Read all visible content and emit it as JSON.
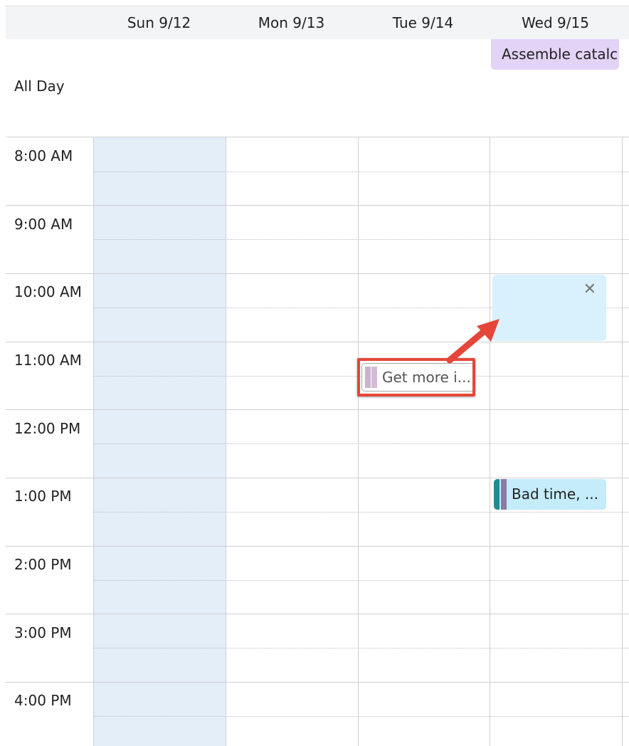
{
  "days": [
    {
      "label": "Sun 9/12"
    },
    {
      "label": "Mon 9/13"
    },
    {
      "label": "Tue 9/14"
    },
    {
      "label": "Wed 9/15"
    }
  ],
  "all_day": {
    "label": "All Day",
    "event_title": "Assemble catalc"
  },
  "hours": [
    {
      "label": "8:00 AM"
    },
    {
      "label": "9:00 AM"
    },
    {
      "label": "10:00 AM"
    },
    {
      "label": "11:00 AM"
    },
    {
      "label": "12:00 PM"
    },
    {
      "label": "1:00 PM"
    },
    {
      "label": "2:00 PM"
    },
    {
      "label": "3:00 PM"
    },
    {
      "label": "4:00 PM"
    }
  ],
  "events": {
    "get_more": {
      "title": "Get more i..."
    },
    "bad_time": {
      "title": "Bad time, ..."
    },
    "selection": {
      "close_icon": "close-icon"
    }
  },
  "colors": {
    "highlight": "#e4473a",
    "sunday_bg": "#e3eef9",
    "allday_event_bg": "#e3d3f7",
    "selection_bg": "#d9f1fc",
    "bad_time_bg": "#c4ecfb"
  }
}
